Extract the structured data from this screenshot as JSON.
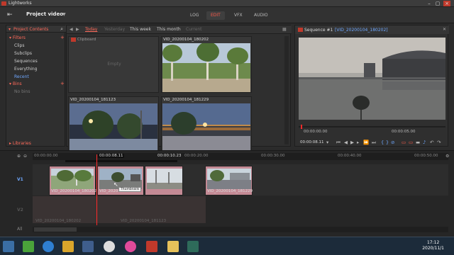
{
  "window": {
    "title": "Lightworks"
  },
  "topbar": {
    "exit_icon": "exit-icon",
    "project_name": "Project video",
    "tabs": [
      {
        "label": "LOG"
      },
      {
        "label": "EDIT",
        "active": true
      },
      {
        "label": "VFX"
      },
      {
        "label": "AUDIO"
      }
    ]
  },
  "project": {
    "title": "Project Contents",
    "filters_label": "Filters",
    "filters": [
      "Clips",
      "Subclips",
      "Sequences",
      "Everything",
      "Recent"
    ],
    "bins_label": "Bins",
    "no_bins": "No bins",
    "libraries_label": "Libraries"
  },
  "browser": {
    "tabs": [
      "Today",
      "Yesterday",
      "This week",
      "This month",
      "Current"
    ],
    "tiles": [
      {
        "name": "Clipboard",
        "empty_text": "Empty"
      },
      {
        "name": "VID_20200104_180202"
      },
      {
        "name": "VID_20200104_181123"
      },
      {
        "name": "VID_20200104_181229"
      }
    ]
  },
  "viewer": {
    "sequence_label": "Sequence #1",
    "clip_label": "[VID_20200104_180202]",
    "tc_start": "00:00:00.00",
    "tc_end": "00:00:05.00",
    "current_tc": "00:00:08.11"
  },
  "timeline": {
    "ruler": [
      "00:00:00.00",
      "00:00:08.11",
      "00:00:10.23",
      "00:00:20.00",
      "00:00:30.00",
      "00:00:40.00",
      "00:00:50.00"
    ],
    "tracks": {
      "v1": "V1",
      "v2": "V2",
      "all": "All"
    },
    "clips": [
      "VID_20200104_180202",
      "VID_2020010",
      "VID_20200104_181229"
    ],
    "ghost_clips": [
      "VID_20200104_180202",
      "VID_20200104_181123"
    ],
    "tooltip": "Thumbnails"
  },
  "taskbar": {
    "time": "17:12",
    "date": "2020/11/1"
  },
  "colors": {
    "accent": "#ff5a4a",
    "link": "#6fa8ff",
    "clip_fill": "#c48a95"
  }
}
